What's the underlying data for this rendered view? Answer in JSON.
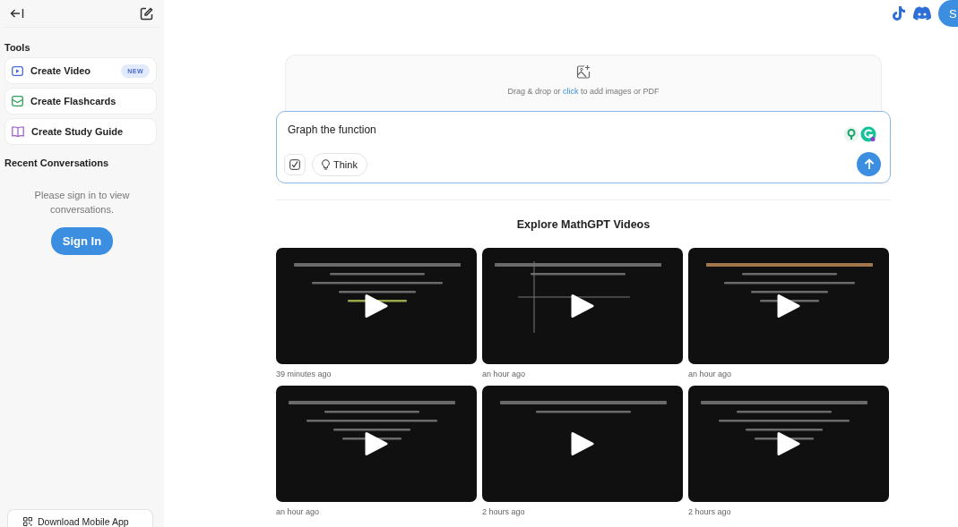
{
  "sidebar": {
    "tools_heading": "Tools",
    "tools": [
      {
        "kind": "video",
        "label": "Create Video",
        "badge": "NEW"
      },
      {
        "kind": "flashcards",
        "label": "Create Flashcards"
      },
      {
        "kind": "guide",
        "label": "Create Study Guide"
      }
    ],
    "recent_heading": "Recent Conversations",
    "empty_message": "Please sign in to view conversations.",
    "sign_in": "Sign In",
    "download": "Download Mobile App"
  },
  "header": {
    "avatar_initial": "S"
  },
  "upload": {
    "text": "Drag & drop or ",
    "link": "click",
    "text_after": " to add images or PDF"
  },
  "composer": {
    "value": "Graph the function",
    "think": "Think"
  },
  "videos": {
    "heading": "Explore MathGPT Videos",
    "items": [
      {
        "kind": "picture",
        "time": "39 minutes ago"
      },
      {
        "kind": "picture",
        "time": "an hour ago"
      },
      {
        "kind": "picture",
        "time": "an hour ago"
      },
      {
        "kind": "picture",
        "time": "an hour ago"
      },
      {
        "kind": "picture",
        "time": "2 hours ago"
      },
      {
        "kind": "picture",
        "time": "2 hours ago"
      }
    ]
  }
}
